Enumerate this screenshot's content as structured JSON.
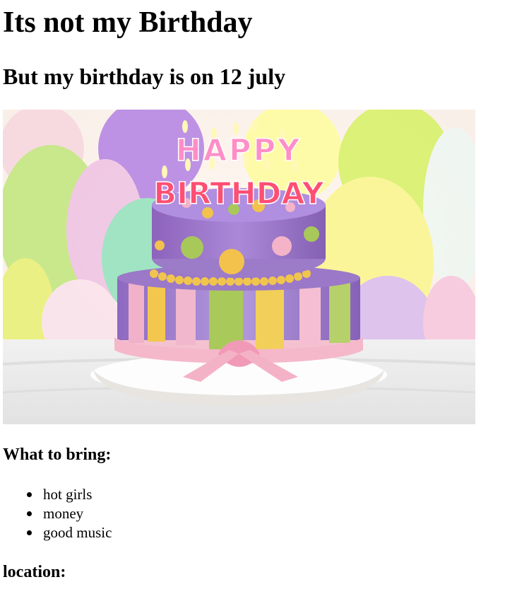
{
  "page": {
    "title": "Its not my Birthday",
    "subtitle": "But my birthday is on 12 july",
    "image": {
      "candle_letters_top": "HAPPY",
      "candle_letters_bottom": "BIRTHDAY"
    },
    "bring": {
      "heading": "What to bring:",
      "items": [
        "hot girls",
        "money",
        "good music"
      ]
    },
    "location": {
      "heading": "location:"
    }
  },
  "colors": {
    "text": "#000000",
    "background": "#ffffff",
    "cake_purple": "#9b78c8",
    "cake_pink": "#f4b3c8",
    "cake_yellow": "#f2c24d",
    "cake_green": "#a8c54f"
  }
}
